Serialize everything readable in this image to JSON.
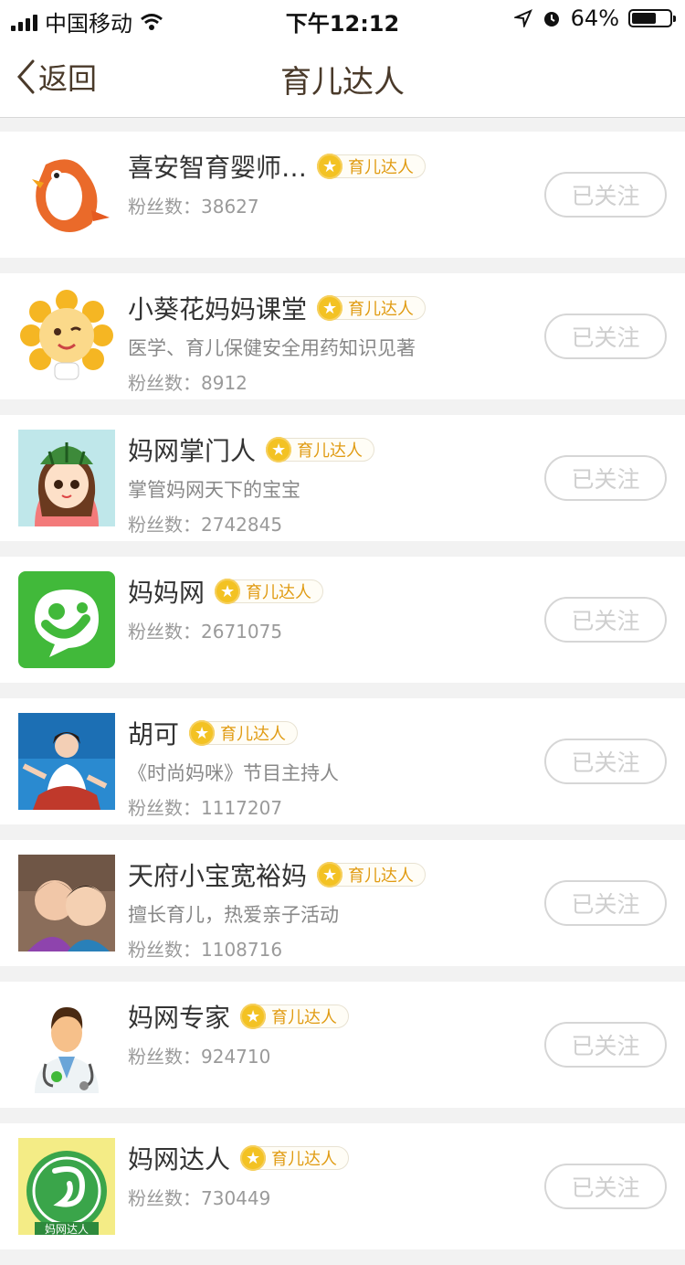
{
  "status": {
    "carrier": "中国移动",
    "time": "下午12:12",
    "battery": "64%",
    "battery_level": 0.64
  },
  "nav": {
    "back_label": "返回",
    "title": "育儿达人"
  },
  "badge_label": "育儿达人",
  "follow_label": "已关注",
  "fans_prefix": "粉丝数：",
  "items": [
    {
      "name": "喜安智育婴师…",
      "desc": "",
      "fans": "38627",
      "avatar": "bird"
    },
    {
      "name": "小葵花妈妈课堂",
      "desc": "医学、育儿保健安全用药知识见著",
      "fans": "8912",
      "avatar": "sunflower"
    },
    {
      "name": "妈网掌门人",
      "desc": "掌管妈网天下的宝宝",
      "fans": "2742845",
      "avatar": "girl"
    },
    {
      "name": "妈妈网",
      "desc": "",
      "fans": "2671075",
      "avatar": "mamawang-logo"
    },
    {
      "name": "胡可",
      "desc": "《时尚妈咪》节目主持人",
      "fans": "1117207",
      "avatar": "photo-woman"
    },
    {
      "name": "天府小宝宽裕妈",
      "desc": "擅长育儿，热爱亲子活动",
      "fans": "1108716",
      "avatar": "photo-kids"
    },
    {
      "name": "妈网专家",
      "desc": "",
      "fans": "924710",
      "avatar": "doctor"
    },
    {
      "name": "妈网达人",
      "desc": "",
      "fans": "730449",
      "avatar": "daren-logo",
      "avatar_text": "妈网达人"
    }
  ]
}
